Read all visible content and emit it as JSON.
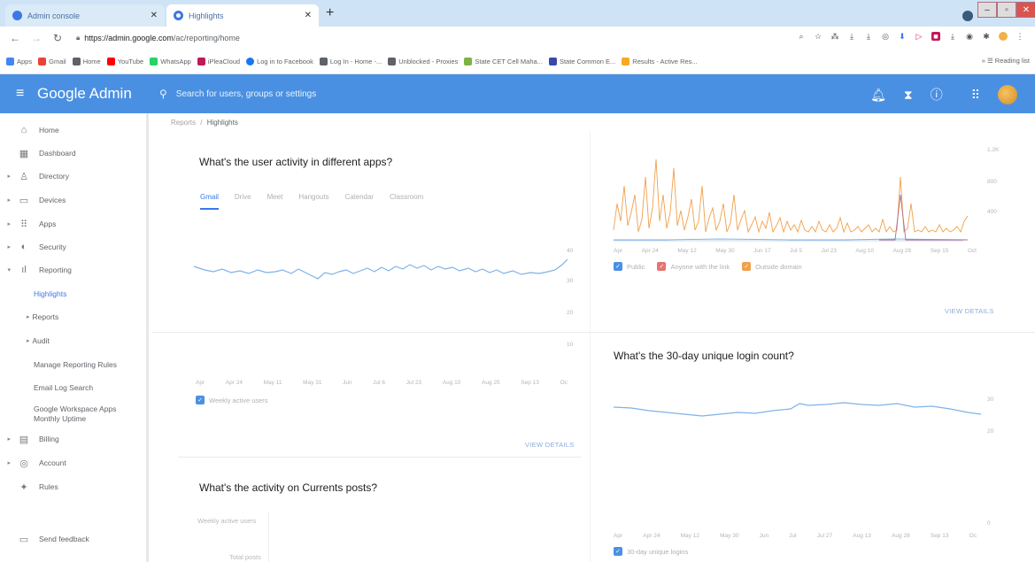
{
  "browser": {
    "tabs": [
      {
        "title": "Admin console",
        "favicon_color": "#3b78e7"
      },
      {
        "title": "Highlights",
        "favicon_color": "#3b78e7"
      }
    ],
    "new_tab_glyph": "+",
    "url_host": "https://admin.google.com",
    "url_path": "/ac/reporting/home",
    "bookmarks": [
      {
        "label": "Apps",
        "color": "#4285f4"
      },
      {
        "label": "Gmail",
        "color": "#ea4335"
      },
      {
        "label": "Home",
        "color": "#5f6368"
      },
      {
        "label": "YouTube",
        "color": "#ff0000"
      },
      {
        "label": "WhatsApp",
        "color": "#25d366"
      },
      {
        "label": "iPleaCloud",
        "color": "#c2185b"
      },
      {
        "label": "Log in to Facebook",
        "color": "#1877f2"
      },
      {
        "label": "Log In - Home -...",
        "color": "#5f6368"
      },
      {
        "label": "Unblocked - Proxies",
        "color": "#5f6368"
      },
      {
        "label": "State CET Cell Maha...",
        "color": "#7cb342"
      },
      {
        "label": "State Common E...",
        "color": "#3949ab"
      },
      {
        "label": "Results - Active Res...",
        "color": "#f9a825"
      }
    ],
    "reading_list": "Reading list"
  },
  "header": {
    "brand": "Google Admin",
    "search_placeholder": "Search for users, groups or settings",
    "icons": [
      "bell-icon",
      "hourglass-icon",
      "help-icon",
      "apps-grid-icon"
    ]
  },
  "sidebar": {
    "items": [
      {
        "label": "Home",
        "icon": "home-icon",
        "caret": false
      },
      {
        "label": "Dashboard",
        "icon": "dashboard-icon",
        "caret": false
      },
      {
        "label": "Directory",
        "icon": "person-icon",
        "caret": true
      },
      {
        "label": "Devices",
        "icon": "devices-icon",
        "caret": true
      },
      {
        "label": "Apps",
        "icon": "apps-icon",
        "caret": true
      },
      {
        "label": "Security",
        "icon": "security-icon",
        "caret": true
      },
      {
        "label": "Reporting",
        "icon": "reporting-icon",
        "caret": true
      }
    ],
    "subitems": [
      {
        "label": "Highlights",
        "active": true
      },
      {
        "label": "Reports",
        "caret": true
      },
      {
        "label": "Audit",
        "caret": true
      },
      {
        "label": "Manage Reporting Rules"
      },
      {
        "label": "Email Log Search"
      },
      {
        "label": "Google Workspace Apps Monthly Uptime"
      }
    ],
    "bottom_items": [
      {
        "label": "Billing",
        "icon": "billing-icon",
        "caret": true
      },
      {
        "label": "Account",
        "icon": "account-icon",
        "caret": true
      },
      {
        "label": "Rules",
        "icon": "rules-icon",
        "caret": false
      }
    ],
    "feedback": "Send feedback"
  },
  "main": {
    "breadcrumb": {
      "parent": "Reports",
      "sep": "/",
      "current": "Highlights"
    },
    "user_activity": {
      "title": "What's the user activity in different apps?",
      "tabs": [
        "Gmail",
        "Drive",
        "Meet",
        "Hangouts",
        "Calendar",
        "Classroom"
      ],
      "active_tab": "Gmail",
      "legend": "Weekly active users",
      "view_details": "VIEW DETAILS"
    },
    "sharing": {
      "legend": [
        "Public",
        "Anyone with the link",
        "Outside domain"
      ],
      "view_details": "VIEW DETAILS"
    },
    "login": {
      "title": "What's the 30-day unique login count?",
      "legend": "30-day unique logins"
    },
    "currents": {
      "title": "What's the activity on Currents posts?",
      "labels": [
        "Weekly active users",
        "Total posts"
      ]
    }
  },
  "colors": {
    "admin_blue": "#4a90e2",
    "line_blue": "#7fb2e8",
    "orange": "#f0a04b",
    "red": "#e57373",
    "checkbox_blue": "#4a90e2",
    "checkbox_orange": "#f0a04b",
    "checkbox_red": "#e57373"
  }
}
